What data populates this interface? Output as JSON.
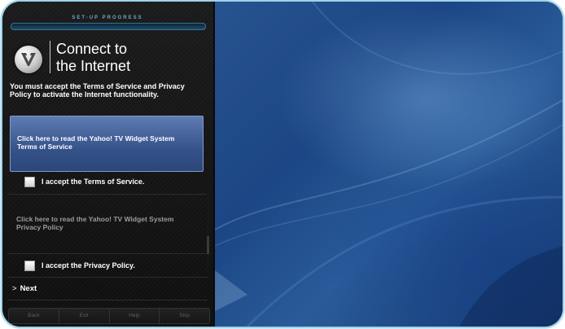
{
  "setup": {
    "progress_label": "SET-UP PROGRESS",
    "title": "Connect to\nthe Internet",
    "instructions": "You must accept the Terms of Service and Privacy Policy to activate the Internet functionality.",
    "tos_link": "Click here to read the Yahoo! TV Widget System Terms of Service",
    "tos_checkbox_label": "I accept the Terms of Service.",
    "privacy_link": "Click here to read the Yahoo! TV Widget System Privacy Policy",
    "privacy_checkbox_label": "I accept the Privacy Policy.",
    "next_label": "Next",
    "buttons": {
      "back": "Back",
      "exit": "Exit",
      "help": "Help",
      "skip": "Skip"
    }
  },
  "colors": {
    "accent": "#3f5d97",
    "progress": "#2b6f9c",
    "background_blue": "#1e4a88"
  },
  "icons": {
    "logo": "vizio-v-logo-icon",
    "next": "chevron-right-icon"
  }
}
